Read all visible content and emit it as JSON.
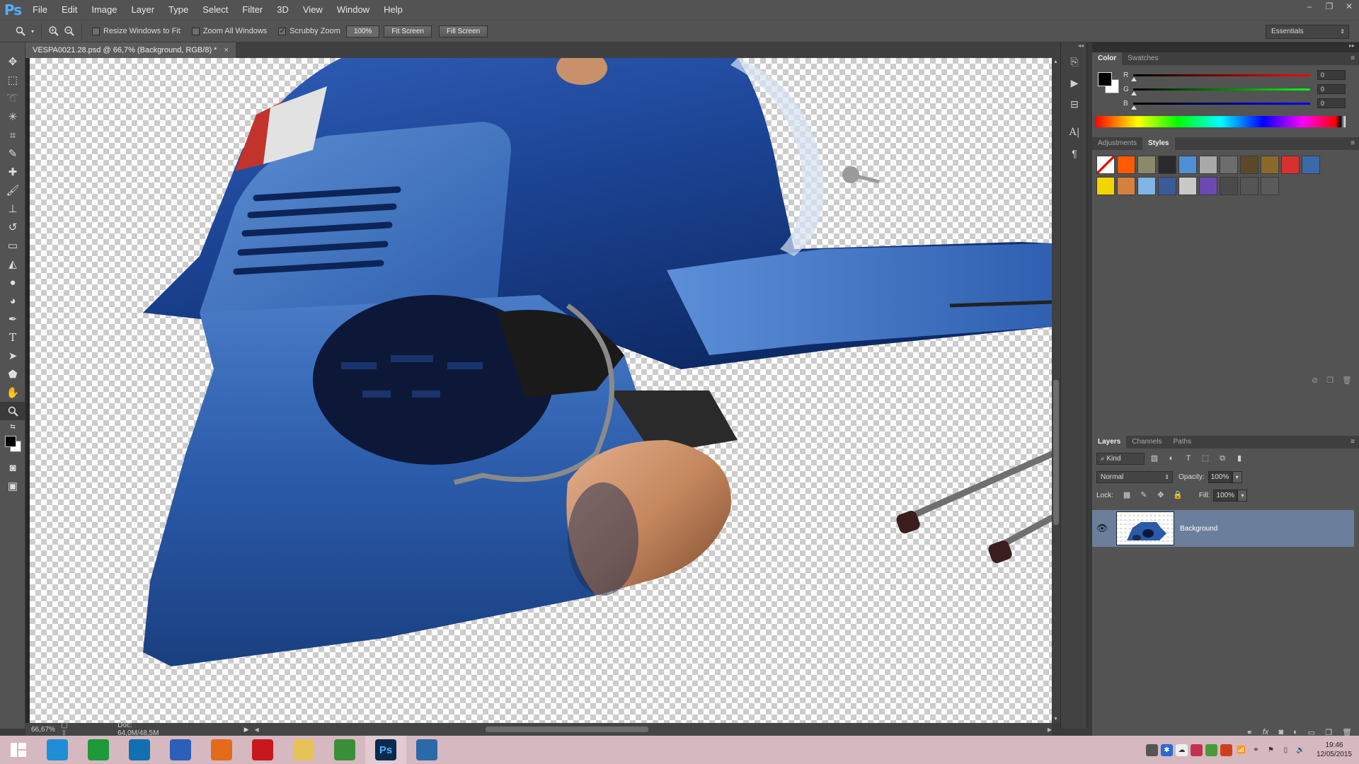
{
  "app": {
    "logo": "Ps",
    "menu": [
      "File",
      "Edit",
      "Image",
      "Layer",
      "Type",
      "Select",
      "Filter",
      "3D",
      "View",
      "Window",
      "Help"
    ],
    "window_controls": [
      "minimize-icon",
      "restore-icon",
      "close-icon"
    ]
  },
  "options": {
    "tool_icon": "zoom-icon",
    "resize_windows_label": "Resize Windows to Fit",
    "resize_windows_checked": false,
    "zoom_all_label": "Zoom All Windows",
    "zoom_all_checked": false,
    "scrubby_label": "Scrubby Zoom",
    "scrubby_checked": true,
    "zoom_field": "100%",
    "fit_screen": "Fit Screen",
    "fill_screen": "Fill Screen",
    "workspace": "Essentials"
  },
  "document": {
    "tab_title": "VESPA0021.28.psd @ 66,7% (Background, RGB/8) *",
    "close": "×",
    "status_zoom": "66,67%",
    "status_doc": "Doc: 64,0M/48,5M"
  },
  "tools": [
    "move-icon",
    "marquee-icon",
    "lasso-icon",
    "magic-wand-icon",
    "crop-icon",
    "eyedropper-icon",
    "healing-brush-icon",
    "brush-icon",
    "clone-stamp-icon",
    "history-brush-icon",
    "eraser-icon",
    "paint-bucket-icon",
    "blur-icon",
    "dodge-icon",
    "pen-icon",
    "type-icon",
    "path-selection-icon",
    "shape-icon",
    "hand-icon",
    "zoom-icon",
    "swap-colors-icon",
    "quick-mask-icon",
    "screen-mode-icon"
  ],
  "color_panel": {
    "tabs": [
      "Color",
      "Swatches"
    ],
    "active_tab": "Color",
    "foreground": "#000000",
    "background": "#ffffff",
    "channels": [
      {
        "label": "R",
        "value": "0",
        "gradient_end": "#ff0000"
      },
      {
        "label": "G",
        "value": "0",
        "gradient_end": "#00ff00"
      },
      {
        "label": "B",
        "value": "0",
        "gradient_end": "#0000ff"
      }
    ]
  },
  "styles_panel": {
    "tabs": [
      "Adjustments",
      "Styles"
    ],
    "active_tab": "Styles",
    "swatches": [
      "#ffffff",
      "#ff5a00",
      "#8a8a6a",
      "#2a2a2a",
      "#4f8fd8",
      "#a9a9a9",
      "#6d6d6d",
      "#5a4a2a",
      "#8a6a2a",
      "#d83030",
      "#3a6aa8",
      "#f4d400",
      "#d68040",
      "#7fb4e6",
      "#3a5a9a",
      "#c8c8c8",
      "#6a4ab0",
      "#4a4a4a",
      "#555555",
      "#5a5a5a"
    ]
  },
  "layers_panel": {
    "tabs": [
      "Layers",
      "Channels",
      "Paths"
    ],
    "active_tab": "Layers",
    "filter_kind": "Kind",
    "blend_mode": "Normal",
    "opacity_label": "Opacity:",
    "opacity": "100%",
    "lock_label": "Lock:",
    "fill_label": "Fill:",
    "fill": "100%",
    "layers": [
      {
        "name": "Background",
        "visible": true,
        "selected": true
      }
    ]
  },
  "taskbar": {
    "apps": [
      {
        "name": "internet-explorer",
        "color": "#1e8fd6",
        "active": false
      },
      {
        "name": "store",
        "color": "#1f9a3a",
        "active": false
      },
      {
        "name": "briefcase",
        "color": "#1170b0",
        "active": false
      },
      {
        "name": "safari",
        "color": "#2c5fb8",
        "active": false
      },
      {
        "name": "firefox",
        "color": "#e36b1b",
        "active": false
      },
      {
        "name": "acrobat",
        "color": "#c8181e",
        "active": false
      },
      {
        "name": "explorer",
        "color": "#e6c35a",
        "active": false
      },
      {
        "name": "chrome",
        "color": "#3a8f3a",
        "active": false
      },
      {
        "name": "photoshop",
        "color": "#0a2a4e",
        "active": true
      },
      {
        "name": "camera-raw",
        "color": "#2a6aa8",
        "active": false
      }
    ],
    "photoshop_label": "Ps",
    "time": "19:46",
    "date": "12/05/2015"
  }
}
